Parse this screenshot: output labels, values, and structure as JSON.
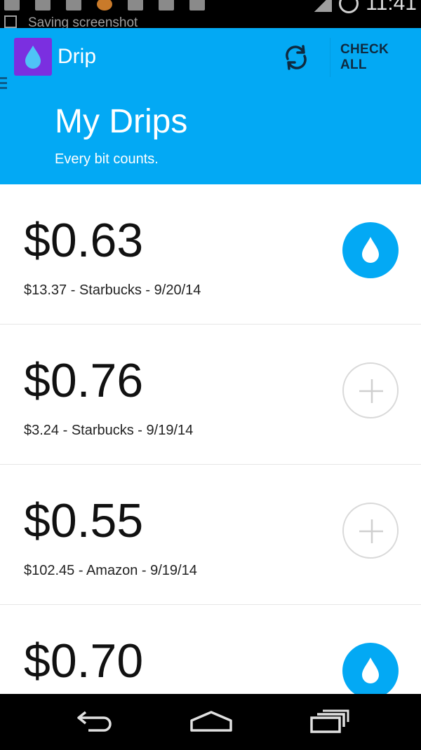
{
  "status_bar": {
    "time": "11:41",
    "notification": "Saving screenshot"
  },
  "app_bar": {
    "app_name": "Drip",
    "action_label": "CHECK ALL",
    "title": "My Drips",
    "subtitle": "Every bit counts."
  },
  "colors": {
    "accent": "#03a9f4",
    "logo": "#7b2fe0"
  },
  "drips": [
    {
      "amount": "$0.63",
      "detail": "$13.37 - Starbucks - 9/20/14",
      "checked": true
    },
    {
      "amount": "$0.76",
      "detail": "$3.24 - Starbucks - 9/19/14",
      "checked": false
    },
    {
      "amount": "$0.55",
      "detail": "$102.45 - Amazon - 9/19/14",
      "checked": false
    },
    {
      "amount": "$0.70",
      "detail": "",
      "checked": true
    }
  ],
  "icons": {
    "menu": "menu-icon",
    "logo": "water-drop-icon",
    "refresh": "refresh-icon",
    "checked": "water-drop-icon",
    "unchecked": "plus-icon",
    "nav_back": "back-icon",
    "nav_home": "home-icon",
    "nav_recents": "recents-icon"
  }
}
